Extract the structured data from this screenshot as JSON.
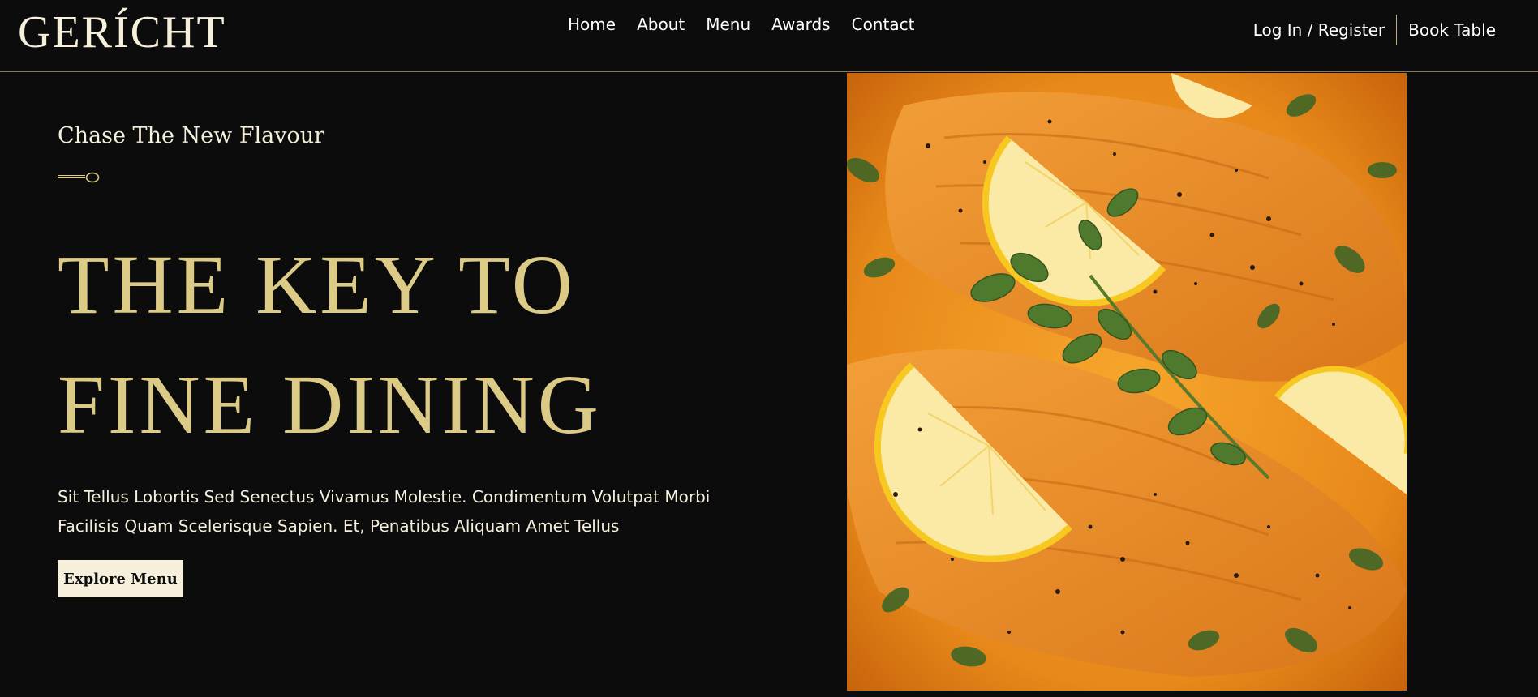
{
  "navbar": {
    "logo": "GERÍCHT",
    "links": [
      "Home",
      "About",
      "Menu",
      "Awards",
      "Contact"
    ],
    "login_label": "Log In / Register",
    "book_label": "Book Table"
  },
  "hero": {
    "subtitle": "Chase The New Flavour",
    "headline_line1": "THE KEY TO",
    "headline_line2": "FINE DINING",
    "body_line1": "Sit Tellus Lobortis Sed Senectus Vivamus Molestie. Condimentum Volutpat Morbi",
    "body_line2": "Facilisis Quam Scelerisque Sapien. Et, Penatibus Aliquam Amet Tellus",
    "cta_label": "Explore Menu"
  },
  "colors": {
    "background": "#0c0c0c",
    "gold": "#dcca87",
    "cream": "#f5efdb"
  },
  "icons": {
    "divider": "spoon-icon"
  }
}
